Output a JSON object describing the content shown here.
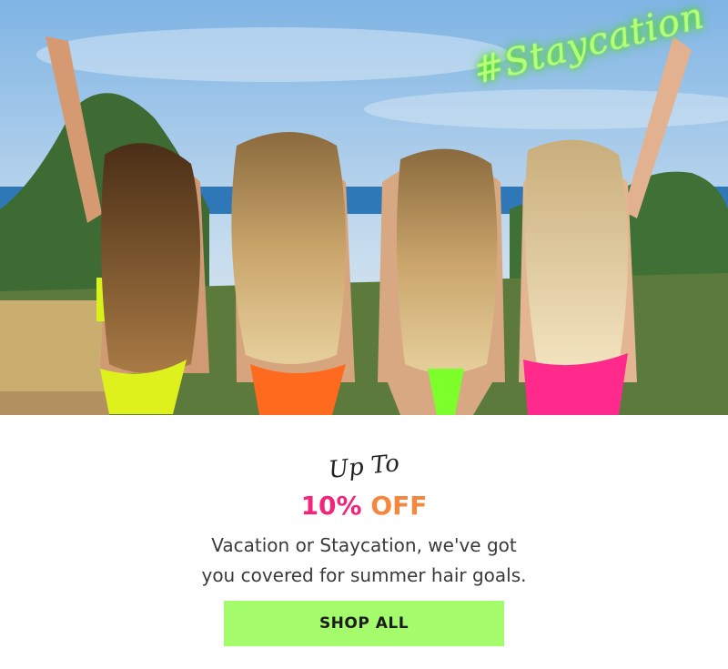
{
  "hero": {
    "hashtag": "#Staycation",
    "bikini_colors": [
      "#d8f21a",
      "#ff6a1f",
      "#7cff2a",
      "#ff2a8c"
    ]
  },
  "promo": {
    "lead": "Up To",
    "offer_percent": "10%",
    "offer_word": "OFF",
    "description_line1": "Vacation or Staycation, we've got",
    "description_line2": "you covered for summer hair goals.",
    "cta_label": "SHOP ALL"
  },
  "colors": {
    "cta_background": "#a4fc6d",
    "offer_pink": "#f1267a",
    "offer_orange": "#f6873f",
    "hashtag_neon": "#b6ff7a"
  }
}
